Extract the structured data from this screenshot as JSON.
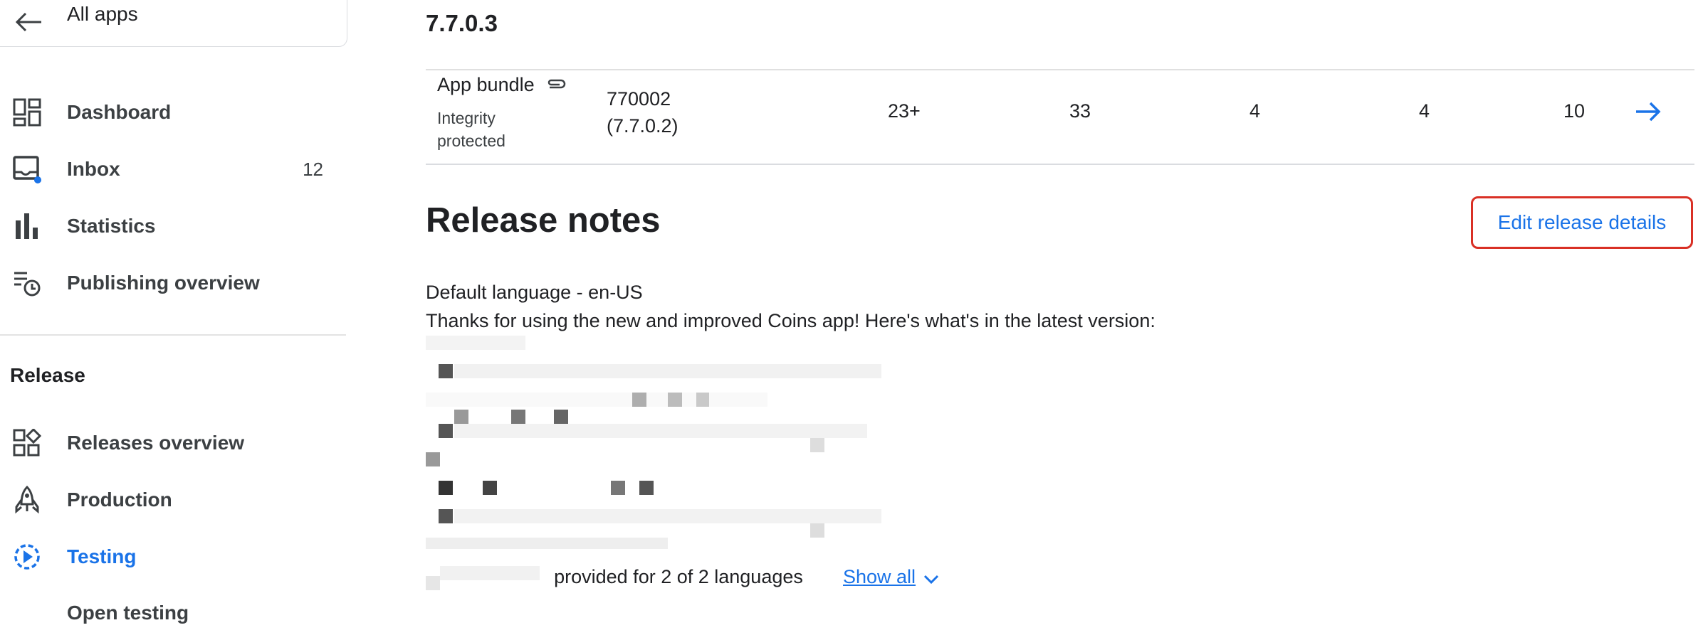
{
  "sidebar": {
    "all_apps_label": "All apps",
    "items": [
      {
        "label": "Dashboard",
        "icon": "dashboard-icon"
      },
      {
        "label": "Inbox",
        "icon": "inbox-icon",
        "count": "12"
      },
      {
        "label": "Statistics",
        "icon": "bar-chart-icon"
      },
      {
        "label": "Publishing overview",
        "icon": "schedule-icon"
      }
    ],
    "section_title": "Release",
    "release_items": [
      {
        "label": "Releases overview",
        "icon": "releases-icon"
      },
      {
        "label": "Production",
        "icon": "rocket-icon"
      },
      {
        "label": "Testing",
        "icon": "testing-icon",
        "active": true
      }
    ],
    "sub_item": "Open testing"
  },
  "main": {
    "version_name": "7.7.0.3",
    "bundle": {
      "type_label": "App bundle",
      "integrity": "Integrity protected",
      "version_code": "770002",
      "version_name": "(7.7.0.2)",
      "api": "23+",
      "screen_layouts": "33",
      "abis": "4",
      "templates": "4",
      "features": "10"
    },
    "release_notes": {
      "title": "Release notes",
      "edit_button": "Edit release details",
      "default_language": "Default language - en-US",
      "intro": "Thanks for using the new and improved Coins app! Here's what's in the latest version:",
      "footer": "Release notes provided for 2 of 2 languages",
      "show_all": "Show all"
    },
    "accent_color": "#1a73e8",
    "highlight_color": "#d93025"
  }
}
